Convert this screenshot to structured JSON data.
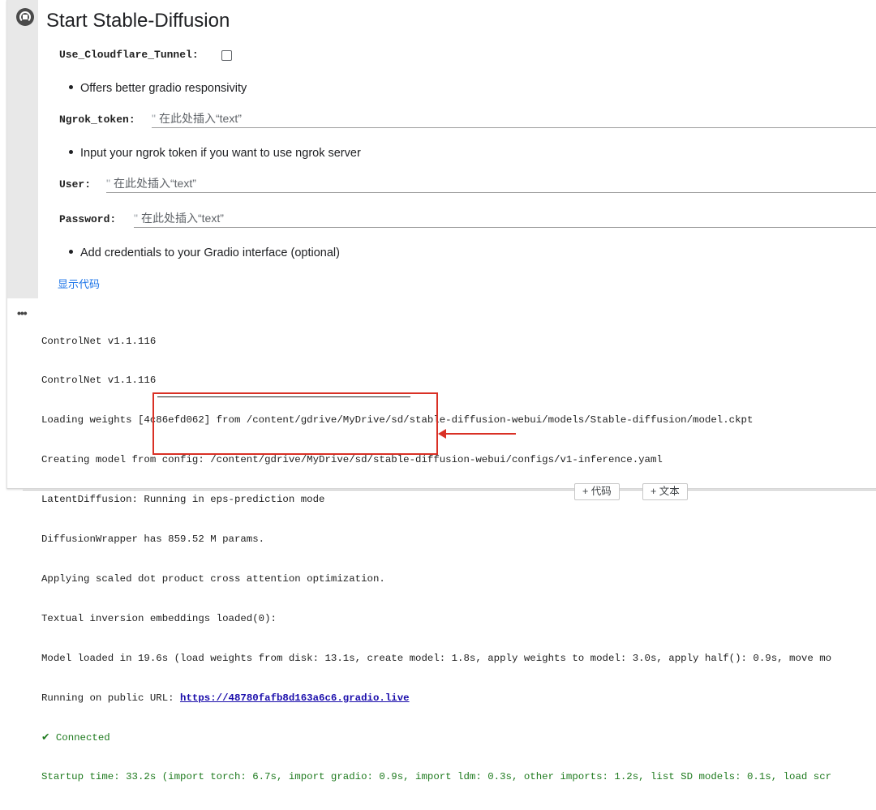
{
  "form": {
    "title": "Start Stable-Diffusion",
    "cloudflare": {
      "label": "Use_Cloudflare_Tunnel:",
      "checked": false
    },
    "bullet_1": "Offers better gradio responsivity",
    "ngrok_token": {
      "label": "Ngrok_token:",
      "placeholder": "在此处插入“text”"
    },
    "bullet_2": "Input your ngrok token if you want to use ngrok server",
    "user": {
      "label": "User:",
      "placeholder": "在此处插入“text”"
    },
    "password": {
      "label": "Password:",
      "placeholder": "在此处插入“text”"
    },
    "bullet_3": "Add credentials to your Gradio interface (optional)",
    "show_code": "显示代码",
    "quote_mark": "\""
  },
  "output": {
    "lines": [
      "ControlNet v1.1.116",
      "ControlNet v1.1.116",
      "Loading weights [4c86efd062] from /content/gdrive/MyDrive/sd/stable-diffusion-webui/models/Stable-diffusion/model.ckpt",
      "Creating model from config: /content/gdrive/MyDrive/sd/stable-diffusion-webui/configs/v1-inference.yaml",
      "LatentDiffusion: Running in eps-prediction mode",
      "DiffusionWrapper has 859.52 M params.",
      "Applying scaled dot product cross attention optimization.",
      "Textual inversion embeddings loaded(0):",
      "Model loaded in 19.6s (load weights from disk: 13.1s, create model: 1.8s, apply weights to model: 3.0s, apply half(): 0.9s, move mo"
    ],
    "url_prefix": "Running on public URL: ",
    "url": "https://48780fafb8d163a6c6.gradio.live",
    "connected": "✔ Connected",
    "startup": "Startup time: 33.2s (import torch: 6.7s, import gradio: 0.9s, import ldm: 0.3s, other imports: 1.2s, list SD models: 0.1s, load scr"
  },
  "toolbar": {
    "add_code": "+ 代码",
    "add_text": "+ 文本"
  },
  "colors": {
    "highlight": "#d93025",
    "link": "#1a0dab",
    "connected": "#1e7a1e",
    "show_code": "#1a73e8"
  },
  "icons": {
    "run": "run-stop-icon",
    "output_menu": "more-horiz-icon"
  }
}
